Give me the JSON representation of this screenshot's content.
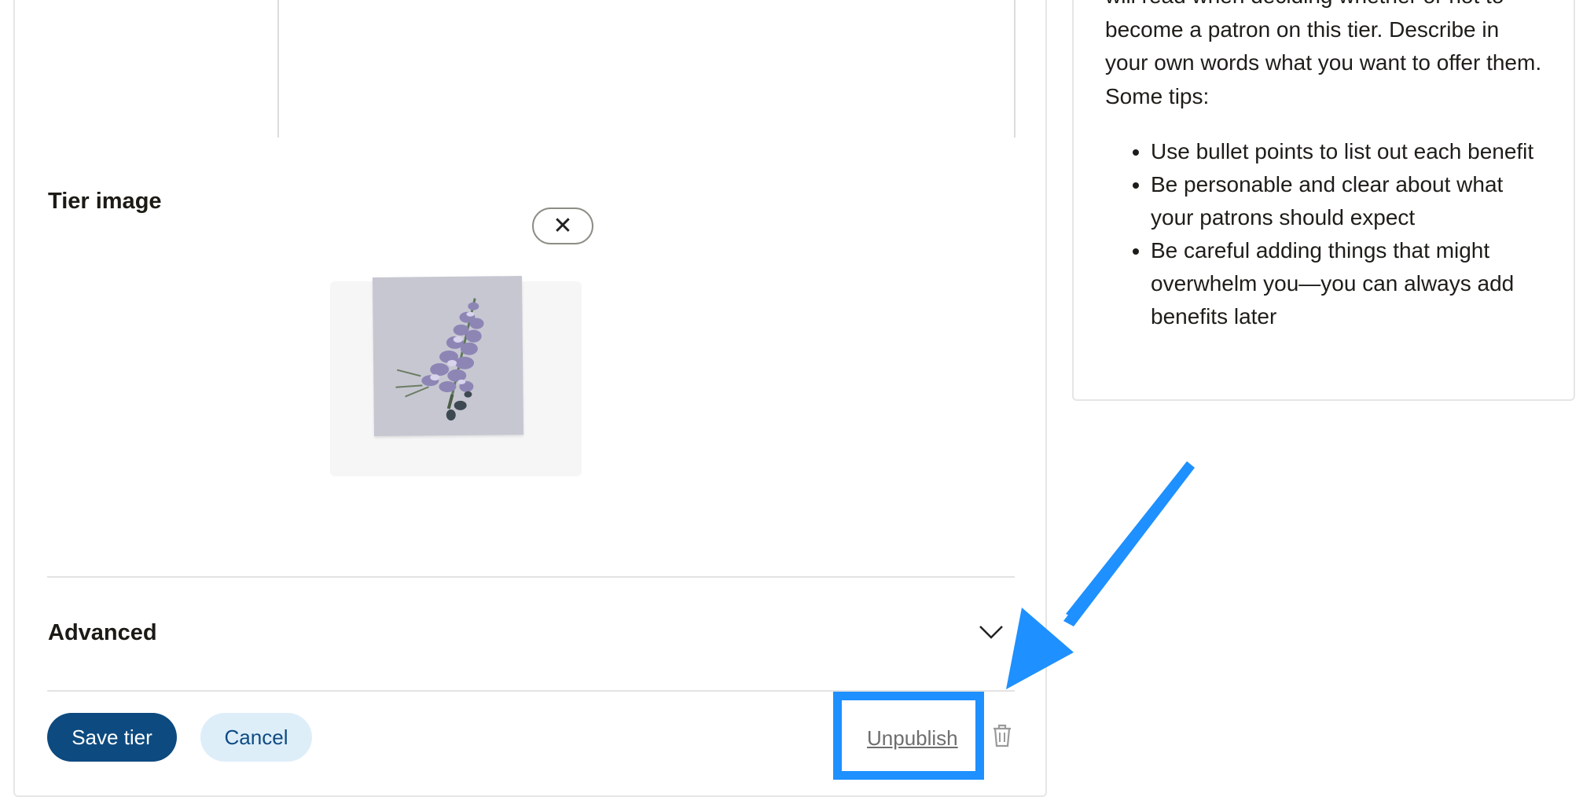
{
  "tier_image": {
    "label": "Tier image",
    "remove_icon": "close-icon"
  },
  "advanced": {
    "label": "Advanced",
    "icon": "chevron-down-icon"
  },
  "actions": {
    "save_label": "Save tier",
    "cancel_label": "Cancel",
    "unpublish_label": "Unpublish",
    "delete_icon": "trash-icon"
  },
  "tips": {
    "intro_top": "will read when deciding whether or not to",
    "intro_rest": "become a patron on this tier. Describe in your own words what you want to offer them. Some tips:",
    "items": [
      "Use bullet points to list out each benefit",
      "Be personable and clear about what your patrons should expect",
      "Be careful adding things that might overwhelm you—you can always add benefits later"
    ]
  },
  "colors": {
    "primary": "#0d4a7f",
    "secondary_bg": "#ddeef9",
    "highlight": "#1e90ff"
  }
}
